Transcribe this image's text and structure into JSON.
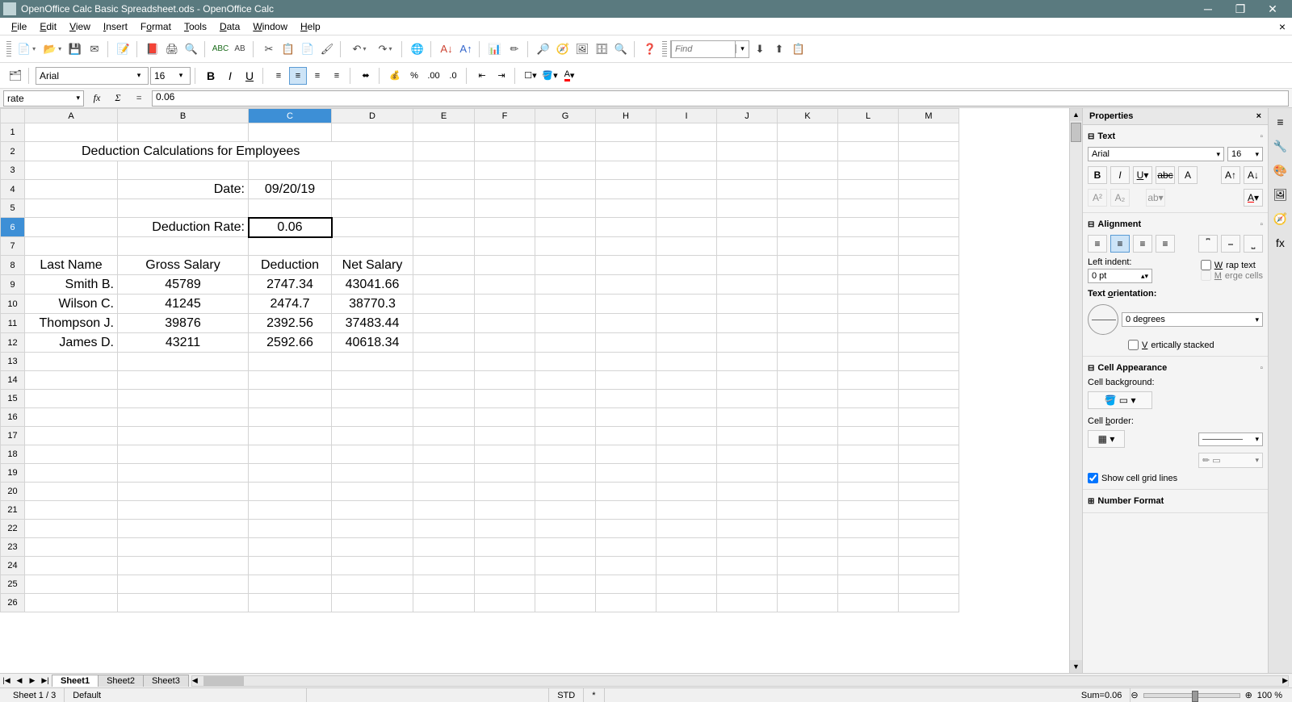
{
  "titlebar": {
    "text": "OpenOffice Calc Basic Spreadsheet.ods - OpenOffice Calc"
  },
  "menu": {
    "file": "File",
    "edit": "Edit",
    "view": "View",
    "insert": "Insert",
    "format": "Format",
    "tools": "Tools",
    "data": "Data",
    "window": "Window",
    "help": "Help"
  },
  "find": {
    "placeholder": "Find"
  },
  "format": {
    "font": "Arial",
    "size": "16"
  },
  "formula": {
    "namebox": "rate",
    "value": "0.06"
  },
  "columns": [
    "A",
    "B",
    "C",
    "D",
    "E",
    "F",
    "G",
    "H",
    "I",
    "J",
    "K",
    "L",
    "M"
  ],
  "selected_col": "C",
  "selected_row": 6,
  "cells": {
    "A2": "Deduction Calculations for Employees",
    "B4": "Date:",
    "C4": "09/20/19",
    "B6": "Deduction Rate:",
    "C6": "0.06",
    "A8": "Last Name",
    "B8": "Gross Salary",
    "C8": "Deduction",
    "D8": "Net Salary",
    "A9": "Smith B.",
    "B9": "45789",
    "C9": "2747.34",
    "D9": "43041.66",
    "A10": "Wilson C.",
    "B10": "41245",
    "C10": "2474.7",
    "D10": "38770.3",
    "A11": "Thompson J.",
    "B11": "39876",
    "C11": "2392.56",
    "D11": "37483.44",
    "A12": "James D.",
    "B12": "43211",
    "C12": "2592.66",
    "D12": "40618.34"
  },
  "sheets": {
    "active": "Sheet1",
    "tabs": [
      "Sheet1",
      "Sheet2",
      "Sheet3"
    ]
  },
  "status": {
    "sheet": "Sheet 1 / 3",
    "style": "Default",
    "mode": "STD",
    "sig": "*",
    "sum": "Sum=0.06",
    "zoom": "100 %"
  },
  "properties": {
    "title": "Properties",
    "text": {
      "title": "Text",
      "font": "Arial",
      "size": "16"
    },
    "alignment": {
      "title": "Alignment",
      "leftindent_label": "Left indent:",
      "leftindent": "0 pt",
      "wrap": "Wrap text",
      "merge": "Merge cells",
      "orientation_label": "Text orientation:",
      "orientation": "0 degrees",
      "vstack": "Vertically stacked"
    },
    "appearance": {
      "title": "Cell Appearance",
      "bg_label": "Cell background:",
      "border_label": "Cell border:",
      "gridlines": "Show cell grid lines"
    },
    "number": {
      "title": "Number Format"
    }
  }
}
